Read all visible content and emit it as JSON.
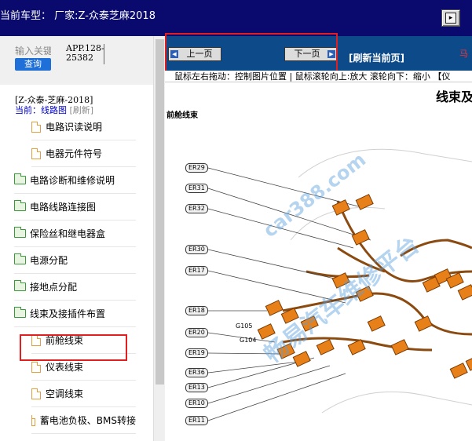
{
  "window": {
    "title": "当前车型：  厂家:Z-众泰芝麻2018",
    "toggle_icon": "play-square-icon",
    "toggle_glyph": "▸"
  },
  "left_panel": {
    "search_placeholder": "输入关键",
    "query_label": "查询",
    "app_code": [
      "APP.128-",
      "25382"
    ],
    "breadcrumb": "[Z-众泰-芝麻-2018]",
    "current_label": "当前：线路图",
    "refresh_label": "[刷新]",
    "tree": [
      {
        "label": "电路识读说明",
        "type": "doc",
        "level": 1
      },
      {
        "label": "电器元件符号",
        "type": "doc",
        "level": 1
      },
      {
        "label": "电路诊断和维修说明",
        "type": "folder",
        "level": 0
      },
      {
        "label": "电路线路连接图",
        "type": "folder",
        "level": 0
      },
      {
        "label": "保险丝和继电器盒",
        "type": "folder",
        "level": 0
      },
      {
        "label": "电源分配",
        "type": "folder",
        "level": 0
      },
      {
        "label": "接地点分配",
        "type": "folder",
        "level": 0
      },
      {
        "label": "线束及接插件布置",
        "type": "folder",
        "level": 0
      },
      {
        "label": "前舱线束",
        "type": "doc",
        "level": 1
      },
      {
        "label": "仪表线束",
        "type": "doc",
        "level": 1
      },
      {
        "label": "空调线束",
        "type": "doc",
        "level": 1
      },
      {
        "label": "蓄电池负极、BMS转接",
        "type": "doc",
        "level": 1
      }
    ]
  },
  "right_panel": {
    "prev_label": "上一页",
    "next_label": "下一页",
    "refresh_page_label": "[刷新当前页]",
    "red_edge_text": "马",
    "hint_text": "鼠标左右拖动：控制图片位置 | 鼠标滚轮向上:放大  滚轮向下：缩小 【仪",
    "diagram": {
      "page_title": "线束及",
      "section_title": "前舱线束",
      "connectors": [
        "ER29",
        "ER31",
        "ER32",
        "ER30",
        "ER17",
        "ER18",
        "ER20",
        "ER19",
        "ER36",
        "ER13",
        "ER10",
        "ER11"
      ],
      "ground_labels": [
        "G105",
        "G104"
      ],
      "watermark_url": "car388.com",
      "watermark_name": "畅易汽车维修平台"
    }
  },
  "colors": {
    "titlebar": "#0a0a6e",
    "navbar": "#0d4a8a",
    "query_button": "#1e6fd8",
    "highlight": "#e02020",
    "connector_orange": "#e8801a"
  }
}
